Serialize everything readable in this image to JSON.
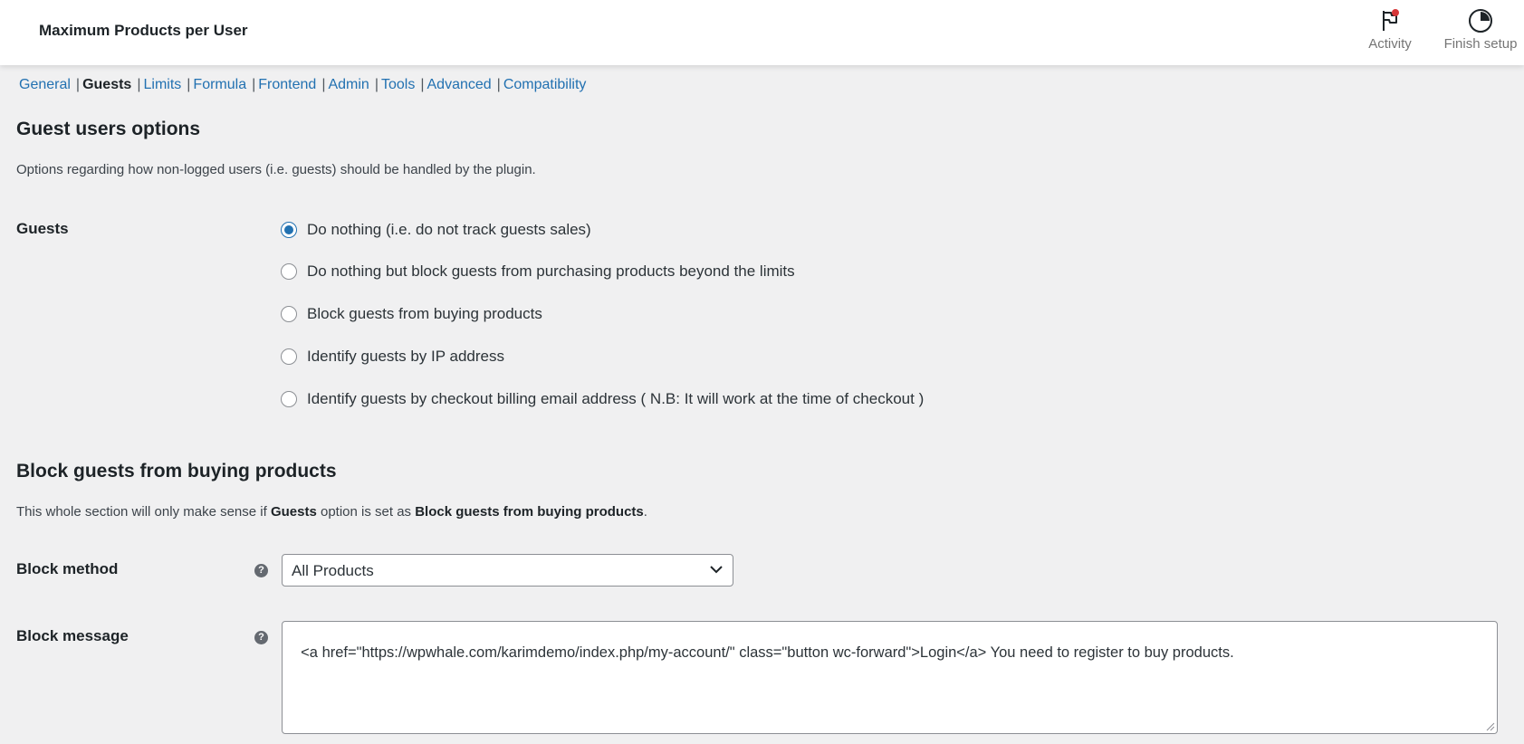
{
  "header": {
    "title": "Maximum Products per User",
    "activity_label": "Activity",
    "finish_setup_label": "Finish setup"
  },
  "subnav": [
    {
      "label": "General",
      "current": false
    },
    {
      "label": "Guests",
      "current": true
    },
    {
      "label": "Limits",
      "current": false
    },
    {
      "label": "Formula",
      "current": false
    },
    {
      "label": "Frontend",
      "current": false
    },
    {
      "label": "Admin",
      "current": false
    },
    {
      "label": "Tools",
      "current": false
    },
    {
      "label": "Advanced",
      "current": false
    },
    {
      "label": "Compatibility",
      "current": false
    }
  ],
  "guest_section": {
    "title": "Guest users options",
    "description": "Options regarding how non-logged users (i.e. guests) should be handled by the plugin.",
    "field_label": "Guests",
    "options": [
      {
        "label": "Do nothing (i.e. do not track guests sales)",
        "checked": true
      },
      {
        "label": "Do nothing but block guests from purchasing products beyond the limits",
        "checked": false
      },
      {
        "label": "Block guests from buying products",
        "checked": false
      },
      {
        "label": "Identify guests by IP address",
        "checked": false
      },
      {
        "label": "Identify guests by checkout billing email address ( N.B: It will work at the time of checkout )",
        "checked": false
      }
    ]
  },
  "block_section": {
    "title": "Block guests from buying products",
    "desc_part1": "This whole section will only make sense if ",
    "desc_bold1": "Guests",
    "desc_part2": " option is set as ",
    "desc_bold2": "Block guests from buying products",
    "desc_part3": ".",
    "method_label": "Block method",
    "method_value": "All Products",
    "message_label": "Block message",
    "message_value": "<a href=\"https://wpwhale.com/karimdemo/index.php/my-account/\" class=\"button wc-forward\">Login</a> You need to register to buy products."
  },
  "colors": {
    "link": "#2271b1",
    "accent": "#2271b1",
    "notification": "#d63638",
    "background": "#f0f0f1"
  }
}
